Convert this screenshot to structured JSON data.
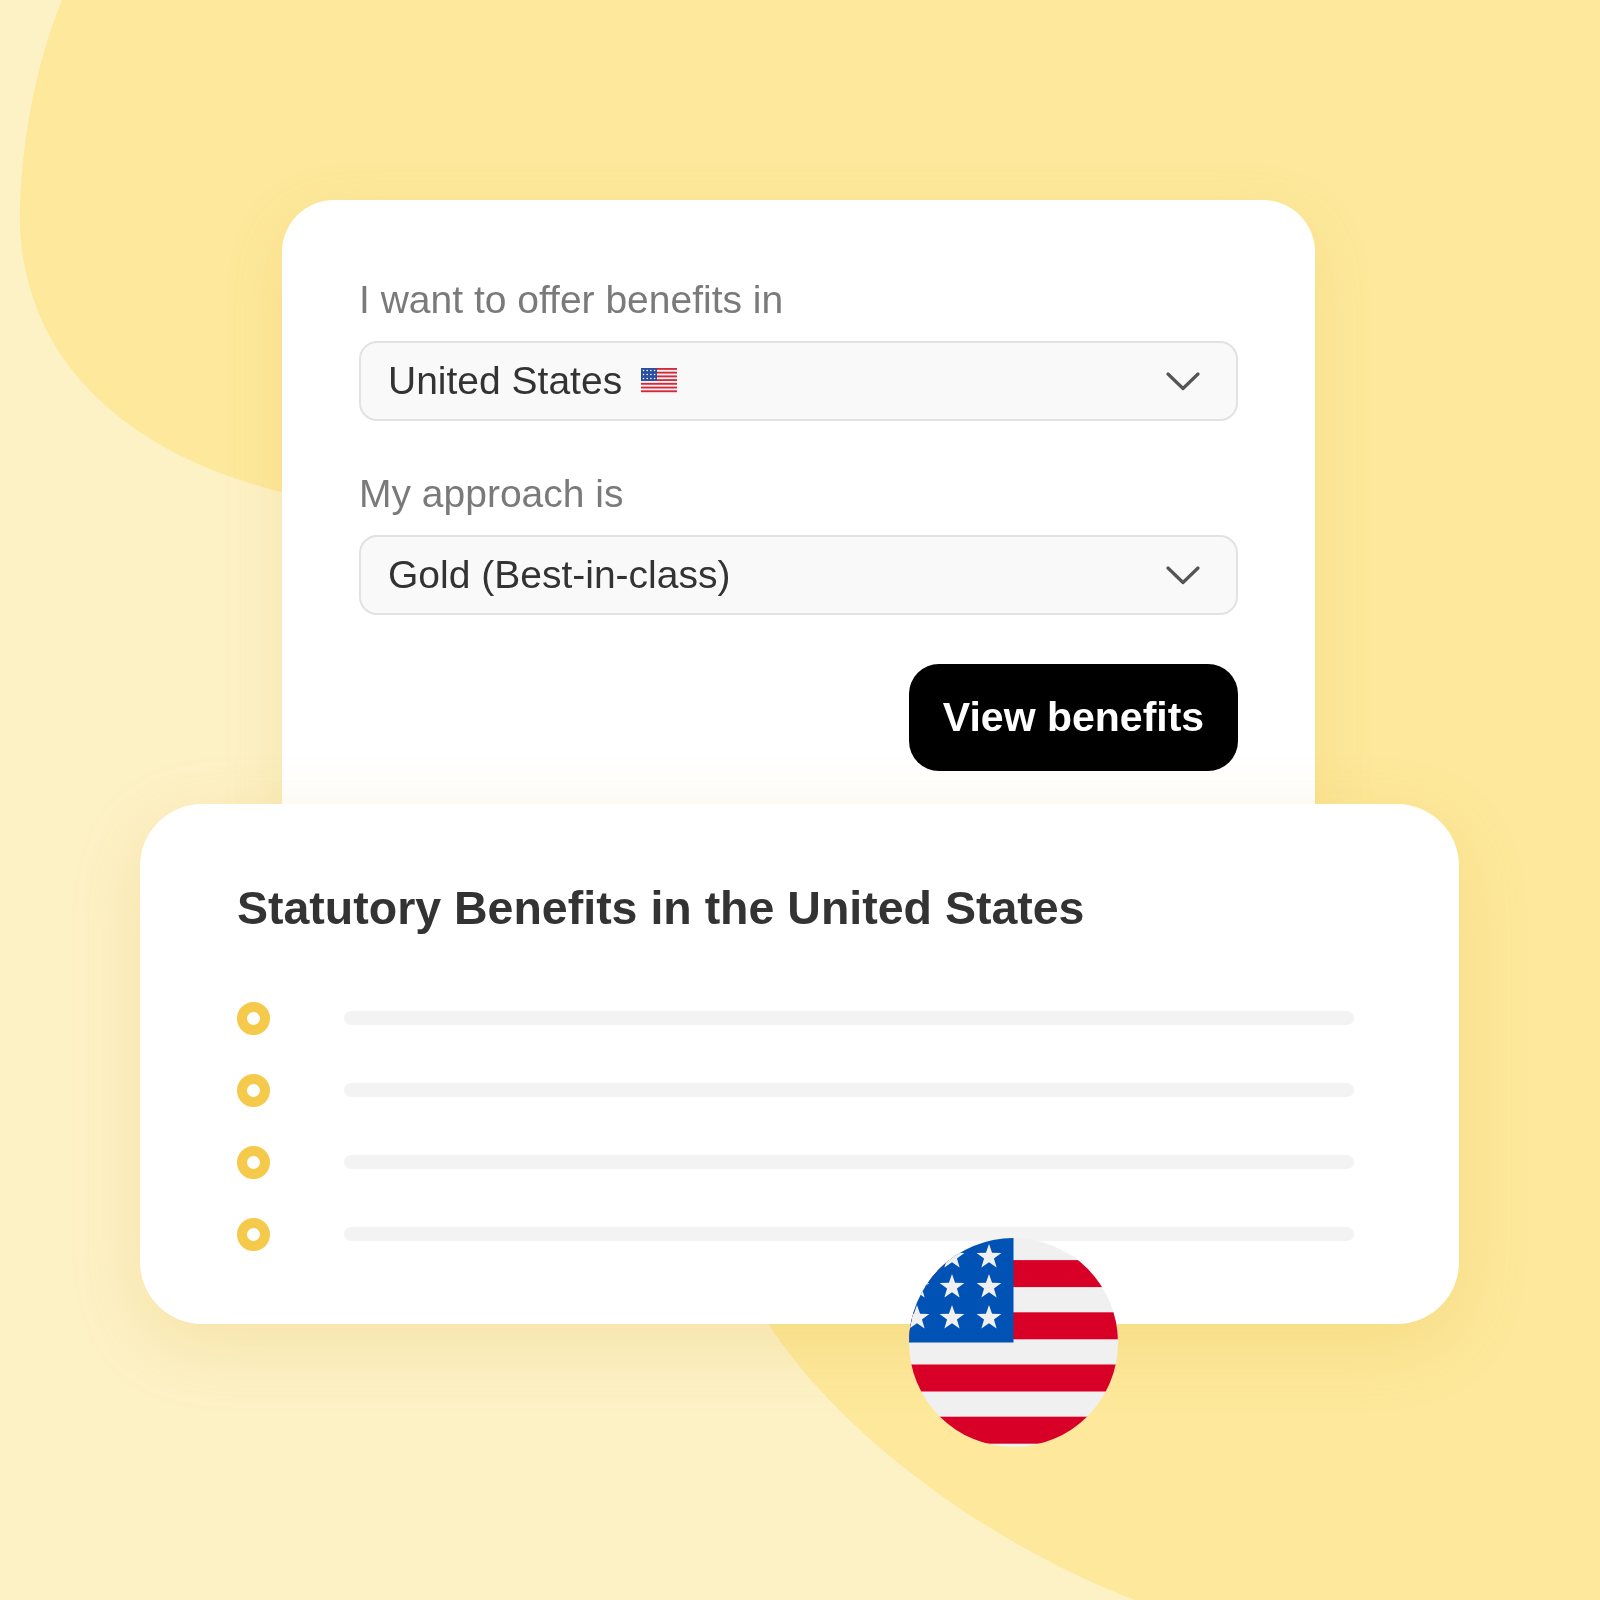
{
  "form": {
    "fields": [
      {
        "kind": "country",
        "label": "I want to offer benefits in",
        "value": "United States"
      },
      {
        "kind": "plain",
        "label": "My approach is",
        "value": "Gold (Best-in-class)"
      }
    ],
    "button": {
      "label": "View benefits"
    }
  },
  "results": {
    "title": "Statutory Benefits in the United States"
  }
}
